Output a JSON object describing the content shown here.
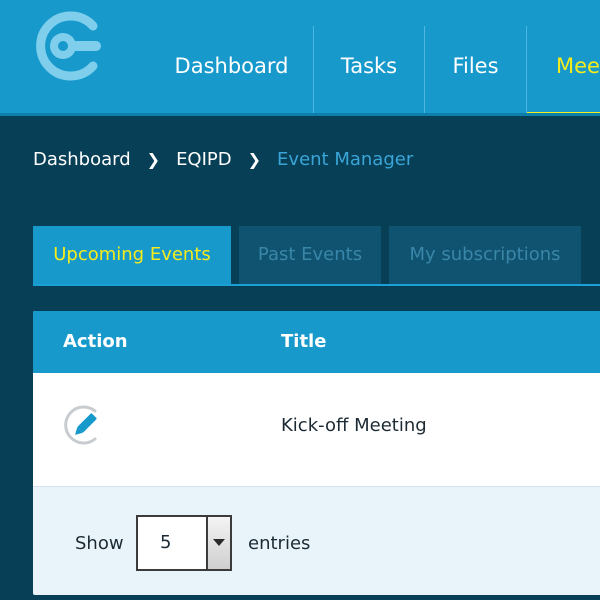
{
  "header": {
    "nav": [
      {
        "label": "Dashboard"
      },
      {
        "label": "Tasks"
      },
      {
        "label": "Files"
      },
      {
        "label": "Mee"
      }
    ]
  },
  "breadcrumb": {
    "items": [
      "Dashboard",
      "EQIPD"
    ],
    "current": "Event Manager"
  },
  "tabs": [
    {
      "label": "Upcoming Events",
      "active": true
    },
    {
      "label": "Past Events",
      "active": false
    },
    {
      "label": "My subscriptions",
      "active": false
    }
  ],
  "table": {
    "columns": [
      "Action",
      "Title"
    ],
    "rows": [
      {
        "action_icon": "edit-icon",
        "title": "Kick-off Meeting"
      }
    ]
  },
  "pagination": {
    "show_label": "Show",
    "page_size": "5",
    "entries_label": "entries"
  },
  "colors": {
    "header_blue": "#1799cc",
    "page_bg": "#073f57",
    "active_yellow": "#f6ec1b",
    "breadcrumb_current": "#3aa5d6"
  }
}
